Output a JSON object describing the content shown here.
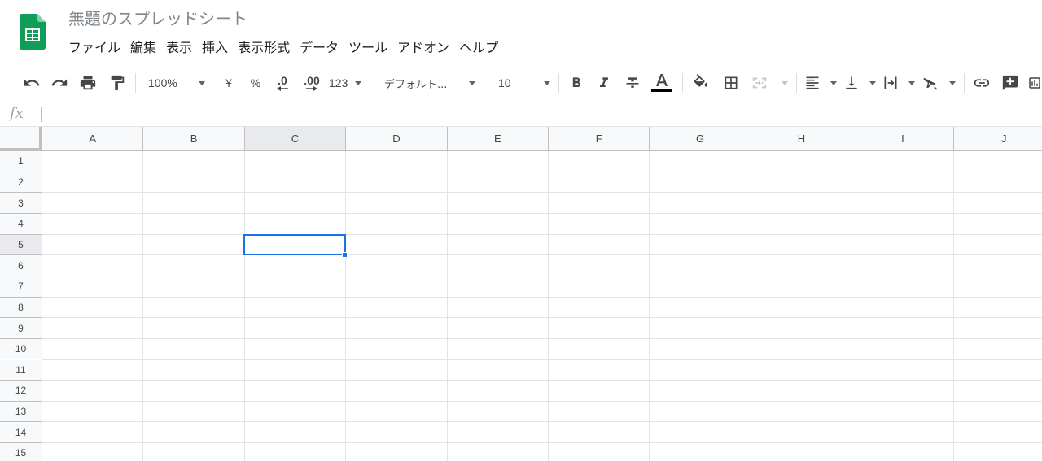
{
  "document": {
    "title": "無題のスプレッドシート"
  },
  "menu": [
    "ファイル",
    "編集",
    "表示",
    "挿入",
    "表示形式",
    "データ",
    "ツール",
    "アドオン",
    "ヘルプ"
  ],
  "toolbar": {
    "zoom": "100%",
    "currency": "¥",
    "percent": "%",
    "decimal_decrease": ".0",
    "decimal_increase": ".00",
    "more_formats": "123",
    "font_family": "デフォルト...",
    "font_size": "10",
    "text_color": "#000000",
    "icons": [
      "undo-icon",
      "redo-icon",
      "print-icon",
      "paint-format-icon",
      "bold-icon",
      "italic-icon",
      "strikethrough-icon",
      "text-color-icon",
      "fill-color-icon",
      "borders-icon",
      "merge-cells-icon",
      "align-left-icon",
      "vertical-align-bottom-icon",
      "text-wrap-icon",
      "text-rotation-icon",
      "link-icon",
      "insert-comment-icon",
      "insert-chart-icon"
    ]
  },
  "formula_bar": {
    "label": "fx",
    "value": ""
  },
  "grid": {
    "columns": [
      "A",
      "B",
      "C",
      "D",
      "E",
      "F",
      "G",
      "H",
      "I",
      "J"
    ],
    "rows": [
      "1",
      "2",
      "3",
      "4",
      "5",
      "6",
      "7",
      "8",
      "9",
      "10",
      "11",
      "12",
      "13",
      "14",
      "15"
    ],
    "selected_cell": {
      "column": "C",
      "row": "5"
    }
  },
  "colors": {
    "brand": "#0f9d58",
    "selection": "#1a73e8",
    "header_bg": "#f8f9fa",
    "grid_line": "#e2e3e3"
  }
}
